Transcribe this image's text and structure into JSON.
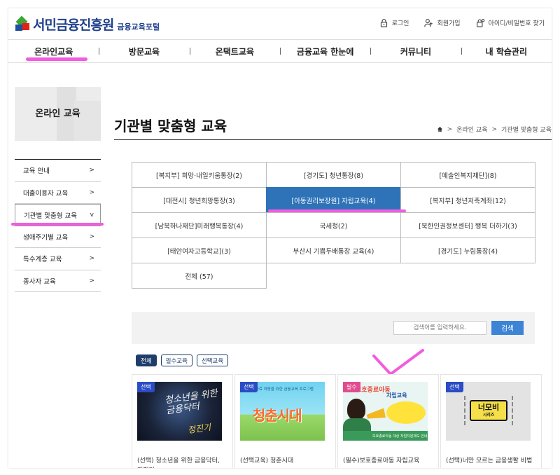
{
  "header": {
    "logo_name": "서민금융진흥원",
    "logo_sub": "금융교육포털",
    "links": [
      {
        "label": "로그인",
        "icon": "lock-icon"
      },
      {
        "label": "회원가입",
        "icon": "user-plus-icon"
      },
      {
        "label": "아이디/비밀번호 찾기",
        "icon": "lock-search-icon"
      }
    ]
  },
  "gnb": [
    "온라인교육",
    "방문교육",
    "온택트교육",
    "금융교육 한눈에",
    "커뮤니티",
    "내 학습관리"
  ],
  "sidebar": {
    "title": "온라인 교육",
    "items": [
      {
        "label": "교육 안내",
        "arrow": ">"
      },
      {
        "label": "대출이용자 교육",
        "arrow": ">"
      },
      {
        "label": "기관별 맞춤형 교육",
        "arrow": "v"
      },
      {
        "label": "생애주기별 교육",
        "arrow": ">"
      },
      {
        "label": "특수계층 교육",
        "arrow": ">"
      },
      {
        "label": "종사자 교육",
        "arrow": ">"
      }
    ]
  },
  "main": {
    "title": "기관별 맞춤형 교육",
    "breadcrumb": [
      ">",
      "온라인 교육",
      ">",
      "기관별 맞춤형 교육"
    ],
    "categories": [
      "[복지부] 희망·내일키움통장(2)",
      "[경기도] 청년통장(8)",
      "[예술인복지재단](8)",
      "[대전시] 청년희망통장(3)",
      "[아동권리보장원] 자립교육(4)",
      "[복지부] 청년저축계좌(12)",
      "[남북하나재단]미래행복통장(4)",
      "국세청(2)",
      "[북한인권정보센터] 행복 더하기(3)",
      "[태안여자고등학교](3)",
      "부산시 기쁨두배통장 교육(4)",
      "[경기도] 누림통장(4)",
      "전체 (57)"
    ],
    "active_category_index": 4,
    "search": {
      "placeholder": "검색어를 입력하세요.",
      "button": "검색"
    },
    "filters": [
      "전체",
      "필수교육",
      "선택교육"
    ],
    "cards": [
      {
        "badge": "선택",
        "title": "(선택) 청소년을 위한 금융닥터, 정진기",
        "thumb_text1": "청소년을 위한 금융닥터",
        "thumb_text2": "정진기"
      },
      {
        "badge": "선택",
        "title": "(선택교육) 청춘시대",
        "thumb_text1": "청춘시대",
        "thumb_text2": "보호 종료 아동을 위한 금융교육 프로그램"
      },
      {
        "badge": "필수",
        "title": "(필수)보호종료아동 자립교육",
        "thumb_text1": "보호종료아동",
        "thumb_text2": "자립교육",
        "thumb_text3": "보호종료아동 대상 자립지원제도 안내"
      },
      {
        "badge": "선택",
        "title": "(선택)너만 모르는 금융생활 비법",
        "thumb_text1": "너모비",
        "thumb_text2": "시리즈"
      }
    ]
  },
  "colors": {
    "active_blue": "#2e73b8",
    "annotation_pink": "#f25ce0",
    "navy": "#1f3d6b"
  }
}
